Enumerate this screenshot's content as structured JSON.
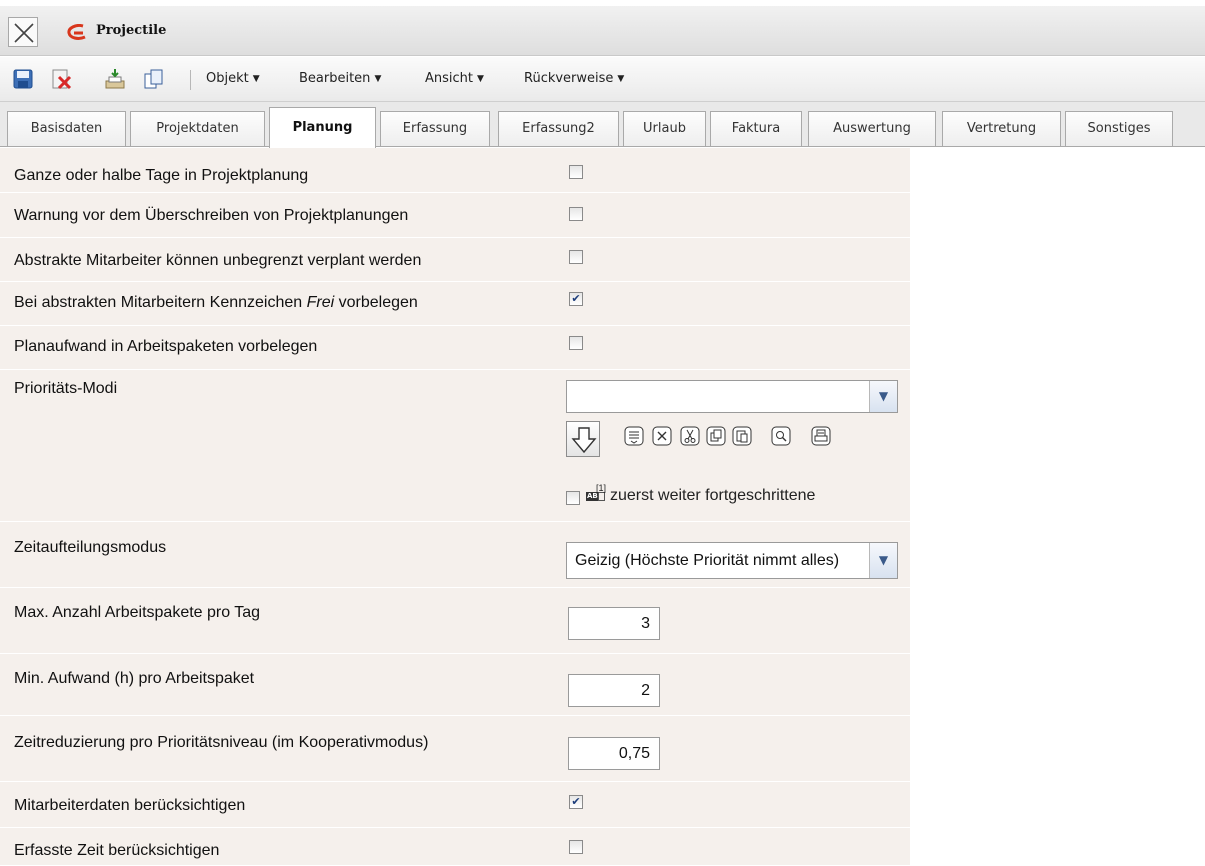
{
  "window": {
    "title": "Projectile"
  },
  "toolbar": {
    "icons": [
      "save-icon",
      "delete-icon",
      "export-icon",
      "copy-icon"
    ],
    "menus": [
      {
        "label": "Objekt"
      },
      {
        "label": "Bearbeiten"
      },
      {
        "label": "Ansicht"
      },
      {
        "label": "Rückverweise"
      }
    ]
  },
  "tabs": [
    {
      "label": "Basisdaten",
      "active": false
    },
    {
      "label": "Projektdaten",
      "active": false
    },
    {
      "label": "Planung",
      "active": true
    },
    {
      "label": "Erfassung",
      "active": false
    },
    {
      "label": "Erfassung2",
      "active": false
    },
    {
      "label": "Urlaub",
      "active": false
    },
    {
      "label": "Faktura",
      "active": false
    },
    {
      "label": "Auswertung",
      "active": false
    },
    {
      "label": "Vertretung",
      "active": false
    },
    {
      "label": "Sonstiges",
      "active": false
    }
  ],
  "form": {
    "ganze_halbe_tage": {
      "label": "Ganze oder halbe Tage in Projektplanung",
      "checked": false
    },
    "warnung_ueberschreiben": {
      "label": "Warnung vor dem Überschreiben von Projektplanungen",
      "checked": false
    },
    "abstrakte_unbegrenzt": {
      "label": "Abstrakte Mitarbeiter können unbegrenzt verplant werden",
      "checked": false
    },
    "abstrakte_frei": {
      "label_before": "Bei abstrakten Mitarbeitern Kennzeichen ",
      "label_italic": "Frei",
      "label_after": " vorbelegen",
      "checked": true
    },
    "planaufwand": {
      "label": "Planaufwand in Arbeitspaketen vorbelegen",
      "checked": false
    },
    "prioritaets_modi": {
      "label": "Prioritäts-Modi",
      "combo_value": "",
      "option_footnote": "[1]",
      "option_label": "zuerst weiter fortgeschrittene",
      "option_checked": false
    },
    "zeitaufteilungsmodus": {
      "label": "Zeitaufteilungsmodus",
      "value": "Geizig (Höchste Priorität nimmt alles)"
    },
    "max_arbeitspakete": {
      "label": "Max. Anzahl Arbeitspakete pro Tag",
      "value": "3"
    },
    "min_aufwand": {
      "label": "Min. Aufwand (h) pro Arbeitspaket",
      "value": "2"
    },
    "zeitreduzierung": {
      "label": "Zeitreduzierung pro Prioritätsniveau (im Kooperativmodus)",
      "value": "0,75"
    },
    "mitarbeiterdaten": {
      "label": "Mitarbeiterdaten berücksichtigen",
      "checked": true
    },
    "erfasste_zeit": {
      "label": "Erfasste Zeit berücksichtigen",
      "checked": false
    }
  }
}
